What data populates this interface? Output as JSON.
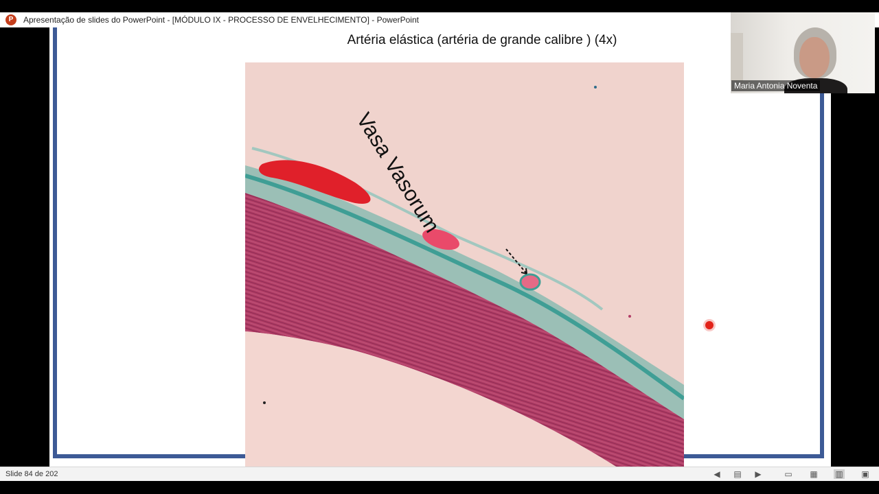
{
  "window": {
    "title": "Apresentação de slides do PowerPoint - [MÓDULO IX - PROCESSO DE ENVELHECIMENTO] - PowerPoint",
    "app_icon": "powerpoint-icon",
    "app_icon_letter": "P"
  },
  "slide": {
    "title": "Artéria elástica (artéria de grande calibre ) (4x)",
    "annotation": "Vasa Vasorum",
    "frame_color": "#3d5a96",
    "laser_pointer_color": "#e2231a"
  },
  "video": {
    "participant_name": "Maria Antonia Noventa"
  },
  "status": {
    "slide_counter": "Slide 84 de 202",
    "icons": [
      "previous-icon",
      "notes-icon",
      "next-icon",
      "normal-view-icon",
      "slide-sorter-icon",
      "reading-view-icon",
      "slideshow-icon"
    ]
  }
}
